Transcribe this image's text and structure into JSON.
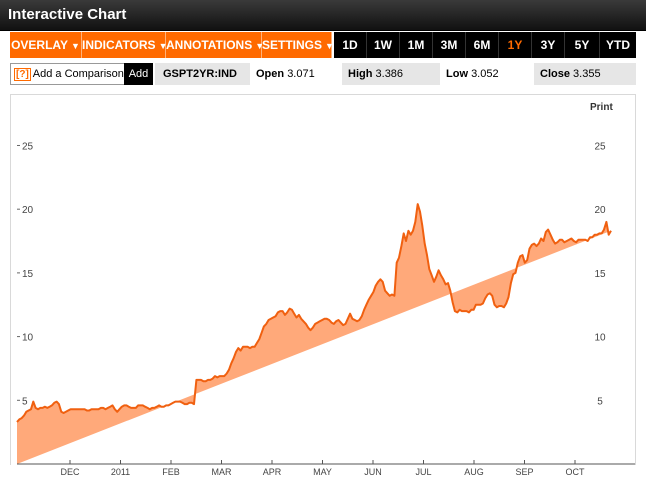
{
  "header": {
    "title": "Interactive Chart"
  },
  "menus": [
    {
      "label": "OVERLAY",
      "caret": "▼"
    },
    {
      "label": "INDICATORS",
      "caret": "▼"
    },
    {
      "label": "ANNOTATIONS",
      "caret": "▼"
    },
    {
      "label": "SETTINGS",
      "caret": "▼"
    }
  ],
  "ranges": [
    "1D",
    "1W",
    "1M",
    "3M",
    "6M",
    "1Y",
    "3Y",
    "5Y",
    "YTD"
  ],
  "active_range": "1Y",
  "comparison": {
    "help": "[?]",
    "placeholder": "Add a Comparison",
    "add_label": "Add"
  },
  "quote": {
    "symbol": "GSPT2YR:IND",
    "open_label": "Open",
    "open": "3.071",
    "high_label": "High",
    "high": "3.386",
    "low_label": "Low",
    "low": "3.052",
    "close_label": "Close",
    "close": "3.355"
  },
  "print_label": "Print",
  "colors": {
    "accent": "#ff6a00",
    "fill": "#ffa97a",
    "line": "#f06010"
  },
  "chart_data": {
    "type": "area",
    "x_labels": [
      "DEC",
      "2011",
      "FEB",
      "MAR",
      "APR",
      "MAY",
      "JUN",
      "JUL",
      "AUG",
      "SEP",
      "OCT"
    ],
    "y_ticks": [
      5,
      10,
      15,
      20,
      25
    ],
    "ylim": [
      0,
      27
    ],
    "grid": false,
    "x": [
      0,
      1,
      2,
      3,
      4,
      5,
      6,
      7,
      8,
      9,
      10,
      11,
      12,
      13,
      14,
      15,
      16,
      17,
      18,
      19,
      20,
      21,
      22,
      23,
      24,
      25,
      26,
      27,
      28,
      29,
      30,
      31,
      32,
      33,
      34,
      35,
      36,
      37,
      38,
      39,
      40,
      41,
      42,
      43,
      44,
      45,
      46,
      47,
      48,
      49,
      50,
      51,
      52,
      53,
      54,
      55,
      56,
      57,
      58,
      59,
      60,
      61,
      62,
      63,
      64,
      65,
      66,
      67,
      68,
      69,
      70,
      71,
      72,
      73,
      74,
      75,
      76,
      77,
      78,
      79,
      80,
      81,
      82,
      83,
      84,
      85,
      86,
      87,
      88,
      89,
      90,
      91,
      92,
      93,
      94,
      95,
      96,
      97,
      98,
      99,
      100,
      101,
      102,
      103,
      104,
      105,
      106,
      107,
      108,
      109,
      110,
      111,
      112,
      113,
      114,
      115,
      116,
      117,
      118,
      119,
      120,
      121,
      122,
      123,
      124,
      125,
      126,
      127,
      128,
      129,
      130,
      131,
      132,
      133,
      134,
      135,
      136,
      137,
      138,
      139,
      140,
      141,
      142,
      143,
      144,
      145,
      146,
      147,
      148,
      149,
      150,
      151,
      152,
      153,
      154,
      155,
      156,
      157,
      158,
      159,
      160,
      161,
      162,
      163,
      164,
      165,
      166,
      167,
      168,
      169,
      170,
      171,
      172,
      173,
      174,
      175,
      176,
      177,
      178,
      179,
      180,
      181,
      182,
      183,
      184,
      185,
      186,
      187,
      188,
      189,
      190,
      191,
      192,
      193,
      194,
      195,
      196,
      197,
      198,
      199,
      200,
      201,
      202,
      203,
      204,
      205,
      206,
      207,
      208,
      209,
      210,
      211,
      212,
      213,
      214,
      215,
      216,
      217,
      218,
      219,
      220,
      221,
      222,
      223,
      224,
      225,
      226,
      227,
      228,
      229,
      230,
      231,
      232,
      233,
      234,
      235,
      236,
      237,
      238,
      239,
      240,
      241,
      242,
      243,
      244,
      245,
      246,
      247,
      248,
      249,
      250,
      251,
      252,
      253,
      254,
      255,
      256,
      257,
      258,
      259,
      260,
      261
    ],
    "y": [
      3.3,
      3.5,
      3.6,
      3.8,
      4.1,
      4.2,
      4.3,
      4.9,
      4.4,
      4.3,
      4.4,
      4.4,
      4.5,
      4.4,
      4.5,
      4.6,
      4.8,
      4.9,
      4.7,
      4.1,
      4.0,
      4.1,
      4.2,
      4.3,
      4.3,
      4.3,
      4.3,
      4.3,
      4.3,
      4.3,
      4.2,
      4.2,
      4.3,
      4.3,
      4.3,
      4.3,
      4.4,
      4.4,
      4.3,
      4.4,
      4.5,
      4.6,
      4.3,
      4.1,
      4.3,
      4.5,
      4.6,
      4.6,
      4.5,
      4.4,
      4.4,
      4.4,
      4.6,
      4.6,
      4.6,
      4.5,
      4.4,
      4.3,
      4.4,
      4.4,
      4.5,
      4.6,
      4.5,
      4.5,
      4.6,
      4.6,
      4.7,
      4.8,
      4.9,
      4.9,
      4.9,
      4.8,
      4.7,
      4.7,
      4.8,
      4.8,
      4.7,
      6.6,
      6.6,
      6.6,
      6.5,
      6.5,
      6.6,
      6.6,
      6.7,
      6.9,
      6.8,
      6.9,
      6.9,
      6.9,
      7.1,
      7.4,
      7.9,
      8.3,
      8.8,
      9.1,
      8.9,
      9.2,
      9.2,
      9.2,
      9.1,
      9.2,
      9.2,
      9.5,
      9.8,
      10.3,
      10.8,
      11.0,
      11.3,
      11.4,
      11.5,
      11.6,
      11.9,
      12.0,
      12.0,
      11.7,
      11.9,
      12.2,
      12.1,
      11.8,
      11.5,
      11.7,
      11.4,
      11.2,
      11.0,
      10.7,
      10.5,
      10.7,
      11.0,
      11.1,
      11.2,
      11.3,
      11.4,
      11.4,
      11.3,
      11.1,
      11.0,
      11.2,
      11.3,
      11.1,
      10.9,
      11.0,
      11.4,
      11.8,
      11.4,
      11.3,
      11.2,
      11.3,
      11.6,
      12.1,
      12.5,
      12.9,
      13.2,
      13.5,
      14.0,
      14.3,
      14.5,
      14.3,
      13.6,
      13.4,
      13.2,
      13.3,
      13.2,
      15.8,
      16.2,
      17.1,
      18.1,
      17.5,
      18.3,
      18.0,
      18.3,
      19.0,
      20.4,
      19.8,
      18.7,
      17.3,
      16.4,
      15.3,
      14.8,
      14.3,
      14.7,
      15.2,
      14.8,
      14.5,
      14.1,
      14.2,
      13.6,
      12.7,
      12.0,
      11.9,
      12.1,
      12.0,
      12.0,
      12.0,
      11.9,
      12.1,
      12.1,
      12.5,
      12.5,
      12.5,
      12.6,
      13.0,
      13.3,
      13.4,
      13.2,
      12.5,
      12.3,
      12.4,
      12.4,
      12.3,
      12.6,
      13.1,
      14.2,
      14.9,
      15.0,
      15.8,
      16.3,
      16.4,
      15.8,
      16.0,
      16.9,
      17.2,
      17.3,
      17.1,
      17.3,
      17.7,
      17.5,
      18.2,
      18.4,
      18.0,
      17.6,
      17.3,
      17.4,
      17.6,
      17.6,
      17.4,
      17.5,
      17.6,
      17.7,
      17.5,
      17.4,
      17.6,
      17.6,
      17.6,
      17.6,
      17.5,
      17.8,
      17.8,
      18.0,
      18.0,
      18.1,
      18.1,
      18.4,
      19.0,
      18.0,
      18.3
    ]
  }
}
